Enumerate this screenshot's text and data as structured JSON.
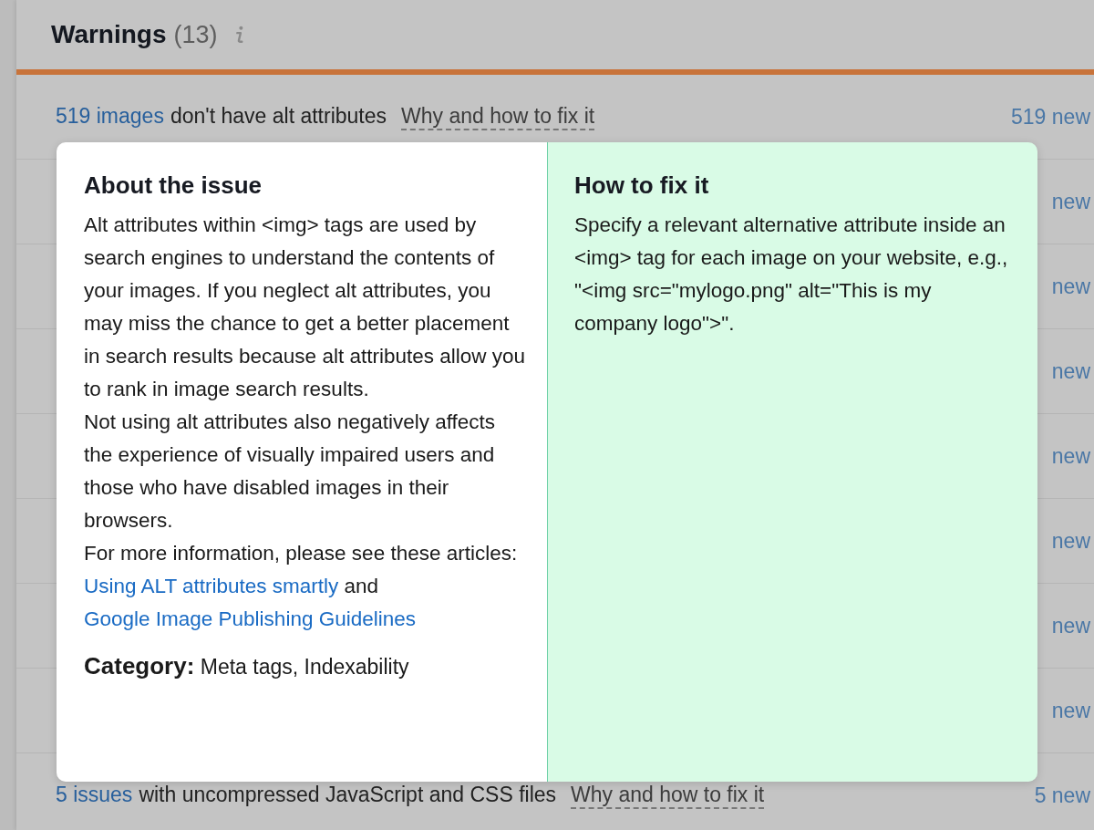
{
  "section": {
    "title": "Warnings",
    "count": "(13)"
  },
  "issues": [
    {
      "count_link": "519 images",
      "text": "don't have alt attributes",
      "help_link": "Why and how to fix it",
      "new_label": "519 new"
    },
    {
      "new_label": "new"
    },
    {
      "new_label": "new"
    },
    {
      "new_label": "new"
    },
    {
      "new_label": "new"
    },
    {
      "new_label": "new"
    },
    {
      "new_label": "new"
    },
    {
      "new_label": "new"
    },
    {
      "count_link": "5 issues",
      "text": "with uncompressed JavaScript and CSS files",
      "help_link": "Why and how to fix it",
      "new_label": "5 new"
    }
  ],
  "popup": {
    "about": {
      "title": "About the issue",
      "paragraphs": [
        [
          {
            "text": "Alt attributes within <img> tags are used by search engines to understand the contents of your images. If you neglect alt attributes, you may miss the chance to get a better placement in search results because alt attributes allow you to rank in image search results."
          }
        ],
        [
          {
            "text": "Not using alt attributes also negatively affects the experience of visually impaired users and those who have disabled images in their browsers."
          }
        ],
        [
          {
            "text": "For more information, please see these articles: "
          },
          {
            "link": "Using ALT attributes smartly"
          },
          {
            "text": " and "
          },
          {
            "link": "Google Image Publishing Guidelines"
          }
        ]
      ],
      "category": "**Category:** Meta tags, Indexability"
    },
    "fix": {
      "title": "How to fix it",
      "text": "Specify a relevant alternative attribute inside an <img> tag for each image on your website, e.g., \"<img src=\"mylogo.png\" alt=\"This is my company logo\">\"."
    }
  }
}
